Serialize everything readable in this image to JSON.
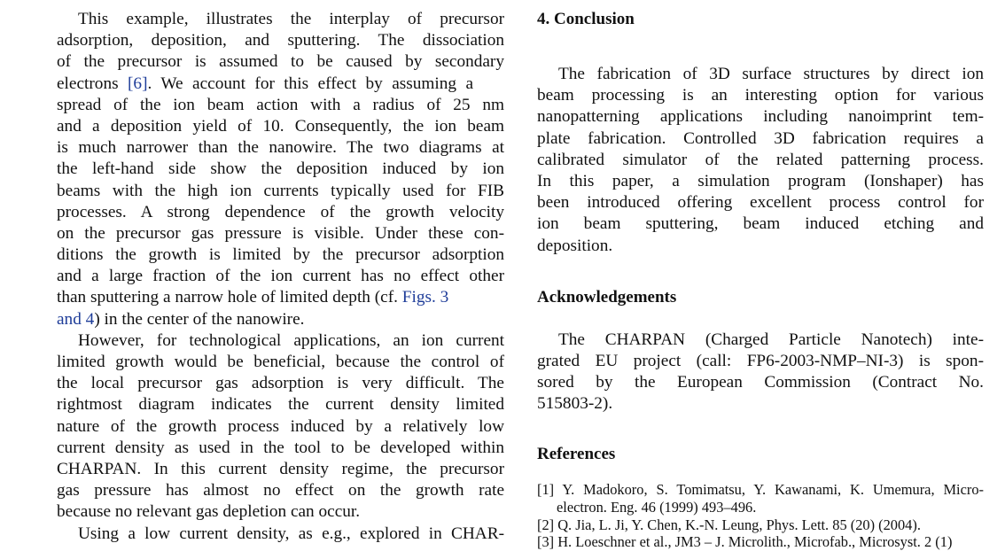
{
  "left_column": {
    "p1": [
      "This example, illustrates the interplay of precursor",
      "adsorption, deposition, and sputtering. The dissociation",
      "of the precursor is assumed to be caused by secondary"
    ],
    "p1_l4_a": "electrons ",
    "p1_l4_link": "[6]",
    "p1_l4_b": ". We account for this effect by assuming a",
    "p1_mid": [
      "spread of the ion beam action with a radius of 25 nm",
      "and a deposition yield of 10. Consequently, the ion beam",
      "is much narrower than the nanowire. The two diagrams at",
      "the left-hand side show the deposition induced by ion",
      "beams with the high ion currents typically used for FIB",
      "processes. A strong dependence of the growth velocity",
      "on the precursor gas pressure is visible. Under these con-",
      "ditions the growth is limited by the precursor adsorption",
      "and a large fraction of the ion current has no effect other"
    ],
    "p1_l13_a": "than sputtering a narrow hole of limited depth (cf. ",
    "p1_l13_link": "Figs. 3",
    "p1_l14_link": "and 4",
    "p1_l14_b": ") in the center of the nanowire.",
    "p2": [
      "However, for technological applications, an ion current",
      "limited growth would be beneficial, because the control of",
      "the local precursor gas adsorption is very difficult. The",
      "rightmost diagram indicates the current density limited",
      "nature of the growth process induced by a relatively low",
      "current density as used in the tool to be developed within",
      "CHARPAN. In this current density regime, the precursor",
      "gas pressure has almost no effect on the growth rate",
      "because no relevant gas depletion can occur."
    ],
    "p3_start": "Using a low current density, as e.g., explored in CHAR-"
  },
  "right_column": {
    "conclusion_heading": "4. Conclusion",
    "conclusion": [
      "The fabrication of 3D surface structures by direct ion",
      "beam processing is an interesting option for various",
      "nanopatterning applications including nanoimprint tem-",
      "plate fabrication. Controlled 3D fabrication requires a",
      "calibrated simulator of the related patterning process.",
      "In this paper, a simulation program (Ionshaper) has",
      "been introduced offering excellent process control for",
      "ion beam sputtering, beam induced etching and",
      "deposition."
    ],
    "ack_heading": "Acknowledgements",
    "ack": [
      "The CHARPAN (Charged Particle Nanotech) inte-",
      "grated EU project (call: FP6-2003-NMP–NI-3) is spon-",
      "sored by the European Commission (Contract No.",
      "515803-2)."
    ],
    "refs_heading": "References",
    "refs": [
      "[1] Y. Madokoro, S. Tomimatsu, Y. Kawanami, K. Umemura, Micro-",
      "electron. Eng. 46 (1999) 493–496.",
      "[2] Q. Jia, L. Ji, Y. Chen, K.-N. Leung, Phys. Lett. 85 (20) (2004).",
      "[3] H. Loeschner et al., JM3 – J. Microlith., Microfab., Microsyst. 2 (1)"
    ]
  }
}
